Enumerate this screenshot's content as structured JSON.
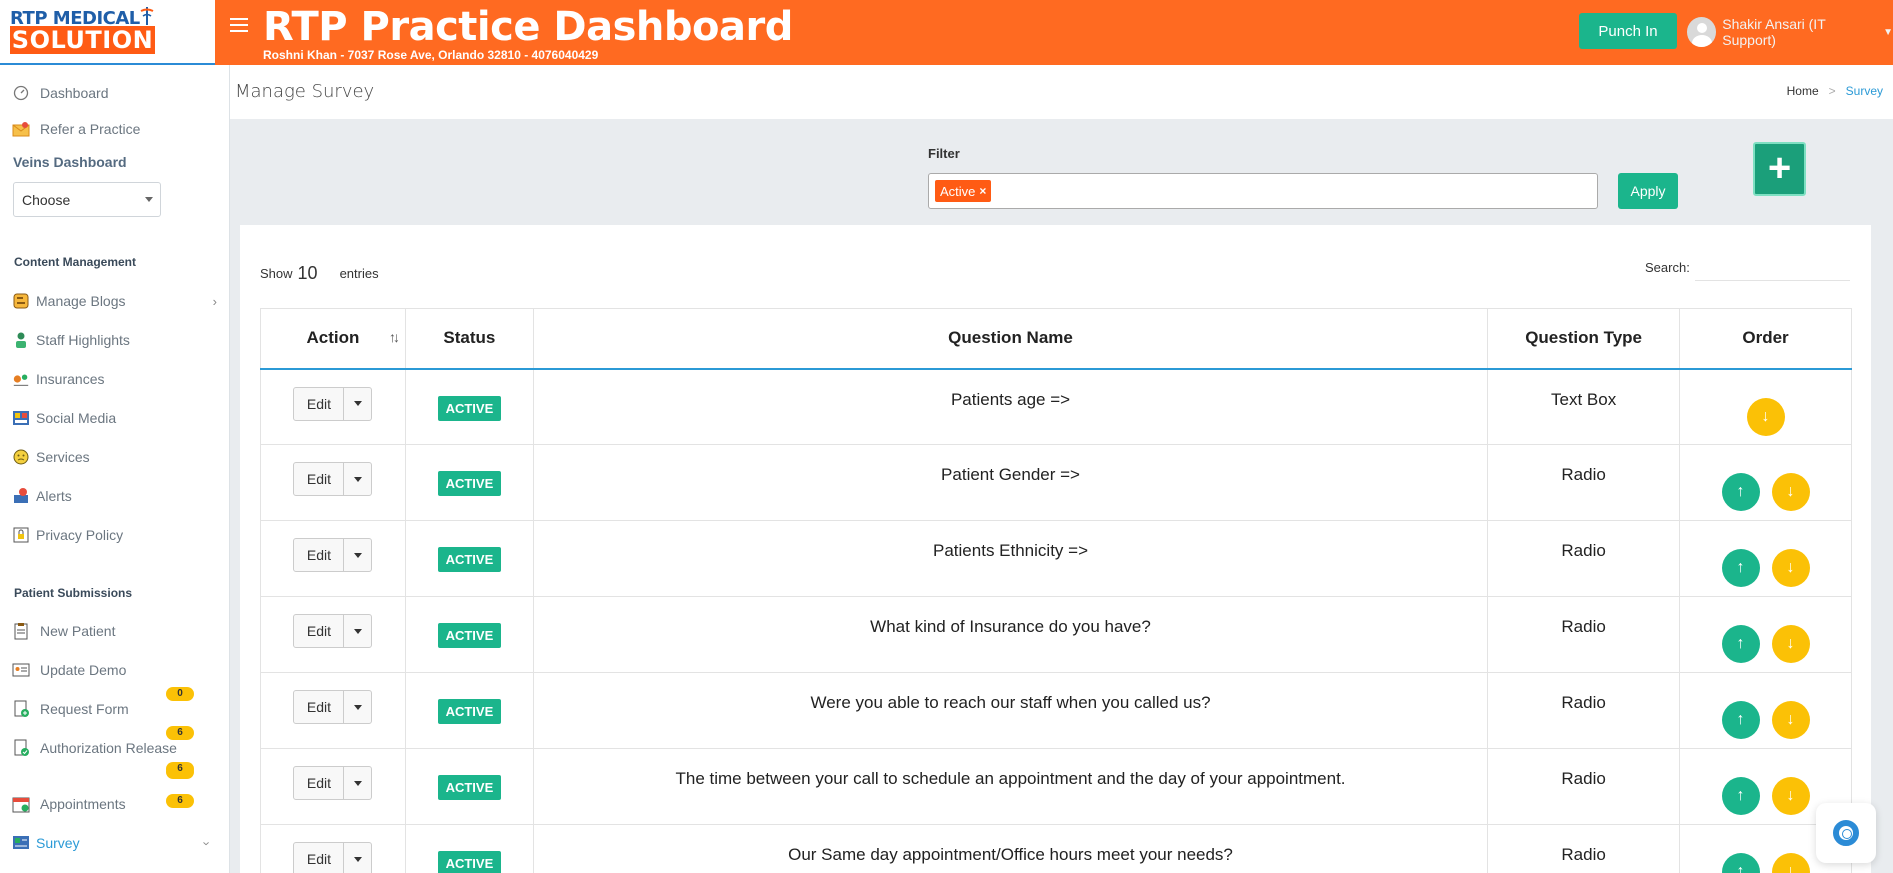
{
  "brand": {
    "logo_top": "RTP MEDICAL",
    "logo_bottom": "SOLUTION",
    "title": "RTP Practice Dashboard",
    "subtitle": "Roshni Khan - 7037 Rose Ave, Orlando 32810 - 4076040429",
    "primary_color": "#ff6a21",
    "accent_color": "#1bb58c"
  },
  "header": {
    "punch_label": "Punch In",
    "user_name": "Shakir Ansari (IT Support)"
  },
  "sidebar": {
    "top_items": [
      {
        "label": "Dashboard",
        "icon": "speedometer-icon"
      },
      {
        "label": "Refer a Practice",
        "icon": "envelope-icon"
      }
    ],
    "veins_title": "Veins Dashboard",
    "veins_select": "Choose",
    "content_title": "Content Management",
    "content_items": [
      {
        "label": "Manage Blogs",
        "icon": "blog-icon"
      },
      {
        "label": "Staff Highlights",
        "icon": "staff-icon"
      },
      {
        "label": "Insurances",
        "icon": "insurance-icon"
      },
      {
        "label": "Social Media",
        "icon": "social-icon"
      },
      {
        "label": "Services",
        "icon": "services-icon"
      },
      {
        "label": "Alerts",
        "icon": "alert-icon"
      },
      {
        "label": "Privacy Policy",
        "icon": "lock-icon"
      }
    ],
    "patient_title": "Patient Submissions",
    "patient_items": [
      {
        "label": "New Patient",
        "badge": "0",
        "icon": "clipboard-icon"
      },
      {
        "label": "Update Demo",
        "badge": "6",
        "icon": "id-card-icon"
      },
      {
        "label": "Request Form",
        "badge": "6",
        "icon": "form-icon"
      },
      {
        "label": "Authorization Release",
        "badge": "6",
        "icon": "authorization-icon"
      },
      {
        "label": "Appointments",
        "badge": "6",
        "icon": "calendar-icon"
      },
      {
        "label": "Survey",
        "icon": "survey-icon"
      }
    ]
  },
  "page": {
    "title": "Manage Survey",
    "breadcrumb_home": "Home",
    "breadcrumb_current": "Survey"
  },
  "filter": {
    "label": "Filter",
    "tag": "Active",
    "tag_remove": "×",
    "apply_label": "Apply",
    "add_label": "+"
  },
  "table": {
    "show_label": "Show",
    "show_count": "10",
    "entries_label": "entries",
    "search_label": "Search:",
    "headers": [
      "Action",
      "Status",
      "Question Name",
      "Question Type",
      "Order"
    ],
    "edit_label": "Edit",
    "rows": [
      {
        "status": "ACTIVE",
        "question": "Patients age =>",
        "type": "Text Box"
      },
      {
        "status": "ACTIVE",
        "question": "Patient Gender =>",
        "type": "Radio"
      },
      {
        "status": "ACTIVE",
        "question": "Patients Ethnicity =>",
        "type": "Radio"
      },
      {
        "status": "ACTIVE",
        "question": "What kind of Insurance do you have?",
        "type": "Radio"
      },
      {
        "status": "ACTIVE",
        "question": "Were you able to reach our staff when you called us?",
        "type": "Radio"
      },
      {
        "status": "ACTIVE",
        "question": "The time between your call to schedule an appointment and the day of your appointment.",
        "type": "Radio"
      },
      {
        "status": "ACTIVE",
        "question": "Our Same day appointment/Office hours meet your needs?",
        "type": "Radio"
      }
    ]
  }
}
